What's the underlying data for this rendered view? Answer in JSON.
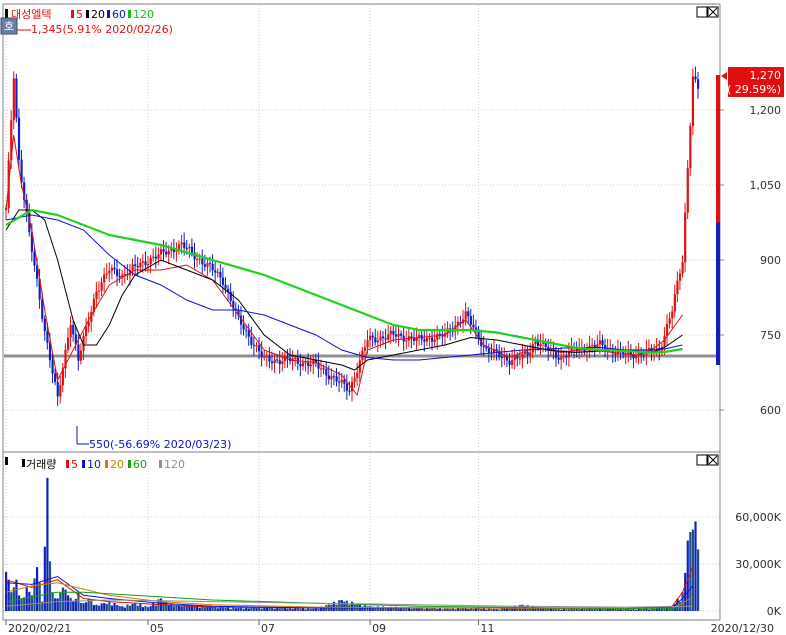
{
  "price_panel": {
    "legend": {
      "name": "대성엘텍",
      "ma_labels": [
        "5",
        "20",
        "60",
        "120"
      ],
      "ma_colors": [
        "#e01010",
        "#000000",
        "#1010d0",
        "#10c010"
      ]
    },
    "high_annotation": "1,345(5.91% 2020/02/26)",
    "low_annotation": "550(-56.69% 2020/03/23)",
    "current_price": "1,270",
    "current_change": "( 29.59%)",
    "y_tick_labels": [
      "1,200",
      "1,050",
      "900",
      "750",
      "600"
    ],
    "mode_badge": "호",
    "window_buttons": [
      "□",
      "⊠"
    ]
  },
  "volume_panel": {
    "legend": {
      "name": "거래량",
      "ma_labels": [
        "5",
        "10",
        "20",
        "60",
        "120"
      ],
      "ma_colors": [
        "#e01010",
        "#1010d0",
        "#d08000",
        "#10a010",
        "#909090"
      ]
    },
    "y_tick_labels": [
      "60,000K",
      "30,000K",
      "0K"
    ],
    "window_buttons": [
      "□",
      "⊠"
    ]
  },
  "x_axis": {
    "labels": [
      "2020/02/21",
      "05",
      "07",
      "09",
      "11",
      "2020/12/30"
    ]
  },
  "colors": {
    "up": "#e01010",
    "down": "#1020c0",
    "ma120": "#20d020",
    "baseline": "#909090",
    "current_box": "#e01010"
  },
  "chart_data": [
    {
      "type": "candlestick",
      "title": "대성엘텍",
      "x_range": [
        "2020/02/21",
        "2020/12/30"
      ],
      "ylim": [
        530,
        1330
      ],
      "y_ticks": [
        600,
        750,
        900,
        1050,
        1200
      ],
      "reference_line": 715,
      "current_price": 1270,
      "current_change_pct": 29.59,
      "high": {
        "value": 1345,
        "pct": 5.91,
        "date": "2020/02/26"
      },
      "low": {
        "value": 550,
        "pct": -56.69,
        "date": "2020/03/23"
      },
      "series": [
        {
          "name": "price",
          "x": [
            0,
            3,
            5,
            9,
            15,
            20,
            25,
            28,
            35,
            40,
            45,
            55,
            68,
            80,
            84,
            90,
            100,
            110,
            120,
            133,
            140,
            150,
            160,
            170,
            178,
            186,
            195,
            200,
            203,
            205,
            210,
            215,
            220,
            230,
            240,
            248,
            253,
            258,
            262,
            266,
            268
          ],
          "values": [
            1000,
            1270,
            1100,
            950,
            760,
            620,
            780,
            700,
            840,
            880,
            870,
            900,
            930,
            880,
            860,
            780,
            700,
            700,
            690,
            640,
            740,
            750,
            740,
            750,
            790,
            720,
            700,
            705,
            720,
            740,
            720,
            705,
            720,
            730,
            710,
            715,
            720,
            800,
            900,
            1270,
            1240
          ]
        },
        {
          "name": "5",
          "x": [
            0,
            3,
            6,
            10,
            15,
            20,
            26,
            32,
            40,
            50,
            60,
            70,
            80,
            90,
            100,
            110,
            120,
            130,
            136,
            140,
            150,
            160,
            170,
            178,
            185,
            195,
            205,
            215,
            225,
            235,
            245,
            250,
            255,
            262
          ],
          "values": [
            1000,
            1150,
            1050,
            960,
            800,
            660,
            720,
            780,
            850,
            880,
            880,
            890,
            860,
            790,
            720,
            700,
            695,
            670,
            630,
            720,
            740,
            745,
            750,
            780,
            730,
            705,
            725,
            715,
            722,
            715,
            710,
            720,
            740,
            790
          ]
        },
        {
          "name": "20",
          "x": [
            0,
            5,
            10,
            15,
            20,
            26,
            30,
            35,
            40,
            45,
            50,
            60,
            70,
            80,
            90,
            100,
            110,
            120,
            130,
            135,
            140,
            150,
            160,
            170,
            180,
            190,
            200,
            210,
            220,
            230,
            240,
            250,
            255,
            262
          ],
          "values": [
            960,
            1000,
            1000,
            980,
            900,
            780,
            730,
            730,
            770,
            830,
            870,
            900,
            880,
            860,
            820,
            750,
            710,
            700,
            690,
            680,
            700,
            710,
            720,
            730,
            745,
            740,
            730,
            720,
            715,
            718,
            720,
            715,
            725,
            750
          ]
        },
        {
          "name": "60",
          "x": [
            0,
            10,
            20,
            30,
            40,
            50,
            60,
            70,
            80,
            90,
            100,
            110,
            120,
            130,
            140,
            150,
            160,
            170,
            180,
            190,
            200,
            210,
            220,
            230,
            240,
            250,
            255,
            262
          ],
          "values": [
            980,
            990,
            980,
            960,
            910,
            870,
            850,
            820,
            800,
            800,
            790,
            770,
            750,
            720,
            705,
            700,
            700,
            705,
            710,
            715,
            720,
            722,
            725,
            725,
            720,
            720,
            722,
            730
          ]
        },
        {
          "name": "120",
          "x": [
            0,
            10,
            20,
            40,
            60,
            80,
            100,
            120,
            140,
            150,
            160,
            170,
            180,
            190,
            200,
            210,
            220,
            230,
            240,
            250,
            255,
            262
          ],
          "values": [
            970,
            1000,
            990,
            950,
            930,
            900,
            870,
            830,
            790,
            770,
            760,
            760,
            760,
            755,
            745,
            735,
            725,
            720,
            718,
            715,
            716,
            722
          ]
        }
      ]
    },
    {
      "type": "bar",
      "title": "거래량",
      "ylim": [
        0,
        90000
      ],
      "y_ticks": [
        0,
        30000,
        60000
      ],
      "unit": "K",
      "series": [
        {
          "name": "volume",
          "x": [
            0,
            2,
            4,
            6,
            8,
            10,
            12,
            14,
            16,
            18,
            20,
            22,
            24,
            26,
            28,
            30,
            32,
            35,
            40,
            45,
            50,
            55,
            60,
            65,
            70,
            80,
            90,
            100,
            110,
            120,
            130,
            140,
            150,
            160,
            170,
            180,
            190,
            200,
            210,
            220,
            230,
            240,
            250,
            258,
            262,
            264,
            266
          ],
          "values": [
            25000,
            12000,
            20000,
            8000,
            15000,
            10000,
            28000,
            6000,
            85000,
            12000,
            8000,
            15000,
            10000,
            6000,
            12000,
            5000,
            8000,
            4000,
            6000,
            3000,
            5000,
            2500,
            8000,
            3000,
            4000,
            2500,
            2000,
            2500,
            2000,
            1500,
            7000,
            3000,
            2500,
            2000,
            1500,
            2000,
            1200,
            4000,
            1500,
            1200,
            1800,
            1200,
            1500,
            2500,
            12000,
            45000,
            52000
          ]
        },
        {
          "name": "5",
          "x": [
            0,
            10,
            20,
            30,
            40,
            60,
            80,
            120,
            160,
            200,
            240,
            258,
            262,
            266
          ],
          "values": [
            20000,
            15000,
            20000,
            8000,
            6000,
            4000,
            2500,
            2000,
            2000,
            1800,
            1500,
            3000,
            12000,
            28000
          ]
        },
        {
          "name": "10",
          "x": [
            0,
            10,
            20,
            30,
            40,
            60,
            80,
            120,
            160,
            200,
            240,
            258,
            262,
            266
          ],
          "values": [
            18000,
            17000,
            22000,
            10000,
            8000,
            5000,
            3000,
            2000,
            2000,
            1800,
            1500,
            2500,
            8000,
            16000
          ]
        },
        {
          "name": "20",
          "x": [
            0,
            10,
            20,
            30,
            40,
            60,
            80,
            120,
            160,
            200,
            240,
            258,
            262,
            266
          ],
          "values": [
            12000,
            16000,
            18000,
            14000,
            10000,
            6000,
            4000,
            2500,
            2000,
            1800,
            1600,
            2000,
            5000,
            9000
          ]
        },
        {
          "name": "60",
          "x": [
            0,
            10,
            20,
            30,
            40,
            60,
            80,
            120,
            160,
            200,
            240,
            258,
            262,
            266
          ],
          "values": [
            6000,
            9000,
            12000,
            12000,
            11000,
            9000,
            7000,
            5000,
            3000,
            2200,
            1800,
            1800,
            2500,
            4000
          ]
        },
        {
          "name": "120",
          "x": [
            0,
            20,
            40,
            60,
            80,
            120,
            160,
            200,
            240,
            266
          ],
          "values": [
            3000,
            6000,
            7000,
            6500,
            6000,
            5000,
            4000,
            3000,
            2500,
            3000
          ]
        }
      ]
    }
  ]
}
